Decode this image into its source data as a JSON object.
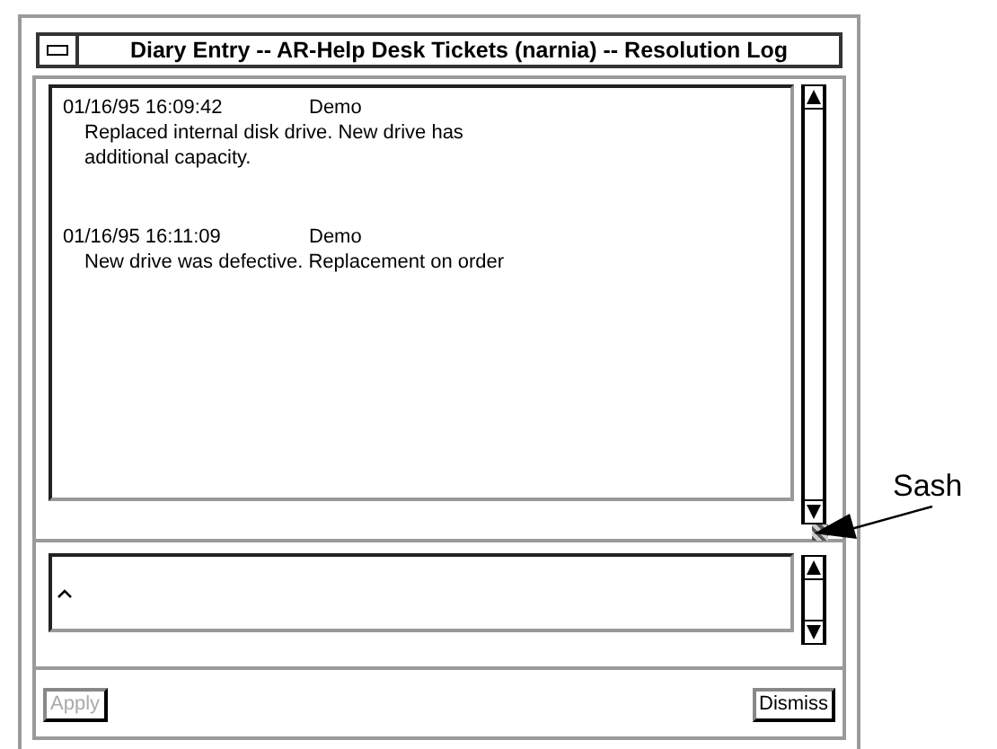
{
  "window": {
    "title": "Diary Entry -- AR-Help Desk Tickets (narnia) -- Resolution Log"
  },
  "entries": [
    {
      "timestamp": "01/16/95 16:09:42",
      "user": "Demo",
      "lines": [
        "Replaced internal disk drive. New drive has",
        "additional capacity."
      ]
    },
    {
      "timestamp": "01/16/95 16:11:09",
      "user": "Demo",
      "lines": [
        "New drive was defective. Replacement on order"
      ]
    }
  ],
  "buttons": [
    {
      "label": "Apply",
      "disabled": true
    },
    {
      "label": "Dismiss",
      "disabled": false
    }
  ],
  "annotation": {
    "label": "Sash"
  }
}
